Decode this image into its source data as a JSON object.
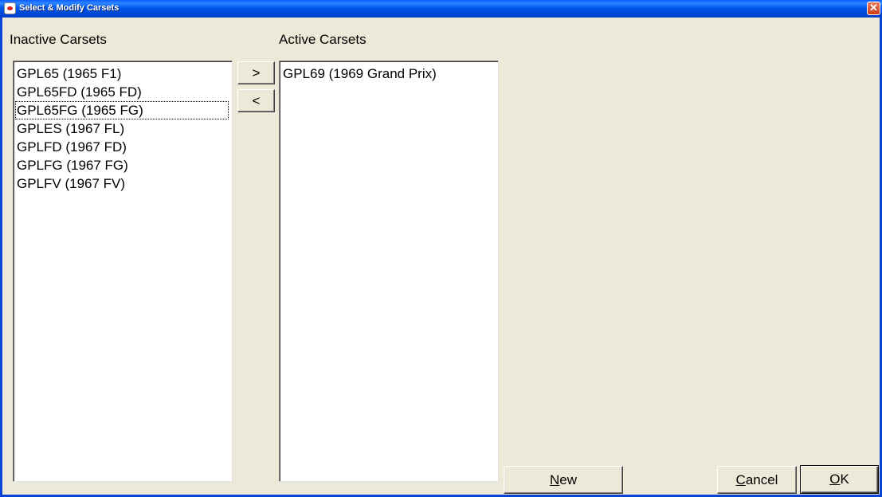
{
  "window": {
    "title": "Select & Modify Carsets",
    "close_glyph": "✕"
  },
  "inactive": {
    "label": "Inactive Carsets",
    "items": [
      "GPL65 (1965 F1)",
      "GPL65FD (1965 FD)",
      "GPL65FG (1965 FG)",
      "GPLES (1967 FL)",
      "GPLFD (1967 FD)",
      "GPLFG (1967 FG)",
      "GPLFV (1967 FV)"
    ],
    "focused_item": "GPL65FG (1965 FG)"
  },
  "active": {
    "label": "Active Carsets",
    "items": [
      "GPL69 (1969 Grand Prix)"
    ]
  },
  "buttons": {
    "move_right": ">",
    "move_left": "<",
    "new_first": "N",
    "new_rest": "ew",
    "cancel_first": "C",
    "cancel_rest": "ancel",
    "ok_first": "O",
    "ok_rest": "K"
  },
  "icons": {
    "app": "app-icon",
    "close": "close-icon"
  },
  "colors": {
    "titlebar": "#0054E3",
    "face": "#ECE9D8",
    "close": "#E04A24"
  }
}
